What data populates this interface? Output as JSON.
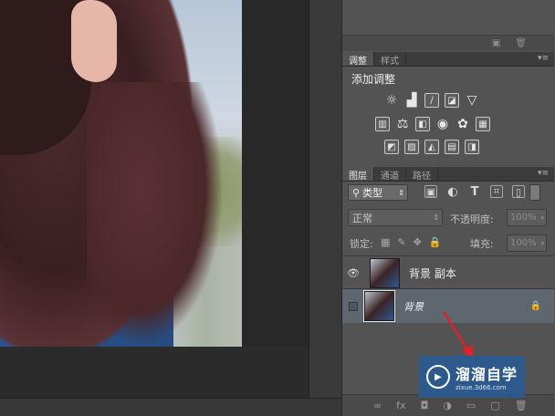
{
  "adjustments_panel": {
    "tabs": [
      "调整",
      "样式"
    ],
    "title": "添加调整",
    "row1": [
      "brightness-icon",
      "levels-icon",
      "curves-icon",
      "exposure-icon",
      "vibrance-icon"
    ],
    "row2": [
      "hue-saturation-icon",
      "color-balance-icon",
      "black-white-icon",
      "photo-filter-icon",
      "channel-mixer-icon",
      "color-lookup-icon"
    ],
    "row3": [
      "invert-icon",
      "posterize-icon",
      "threshold-icon",
      "gradient-map-icon",
      "selective-color-icon"
    ]
  },
  "layers_panel": {
    "tabs": [
      "图层",
      "通道",
      "路径"
    ],
    "kind_filter": "类型",
    "blend_mode": "正常",
    "opacity_label": "不透明度:",
    "opacity_value": "100%",
    "lock_label": "锁定:",
    "fill_label": "填充:",
    "fill_value": "100%",
    "layers": [
      {
        "name": "背景 副本",
        "visible": true,
        "selected": false
      },
      {
        "name": "背景",
        "visible": false,
        "selected": true,
        "locked": true
      }
    ],
    "bottom_icons": [
      "link-icon",
      "fx-icon",
      "mask-icon",
      "adjustment-icon",
      "folder-icon",
      "new-layer-icon",
      "trash-icon"
    ]
  },
  "watermark": {
    "main": "溜溜自学",
    "sub": "zixue.3d66.com"
  },
  "colors": {
    "panel_bg": "#535353",
    "selected_layer": "#5e6670",
    "arrow": "#e0202a",
    "watermark_bg": "#285a96"
  }
}
